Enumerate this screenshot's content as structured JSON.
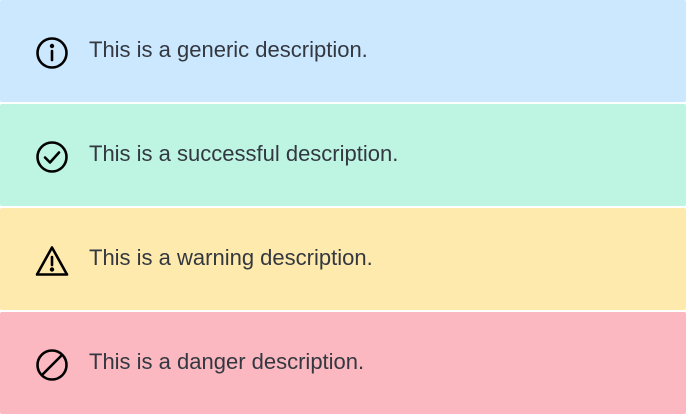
{
  "alerts": [
    {
      "type": "info",
      "icon": "info-circle-icon",
      "message": "This is a generic description.",
      "background": "#cce8ff"
    },
    {
      "type": "success",
      "icon": "check-circle-icon",
      "message": "This is a successful description.",
      "background": "#bef5e2"
    },
    {
      "type": "warning",
      "icon": "warning-triangle-icon",
      "message": "This is a warning description.",
      "background": "#ffeaad"
    },
    {
      "type": "danger",
      "icon": "prohibited-icon",
      "message": "This is a danger description.",
      "background": "#fcb8c0"
    }
  ],
  "colors": {
    "icon": "#000000",
    "text": "#333840"
  }
}
